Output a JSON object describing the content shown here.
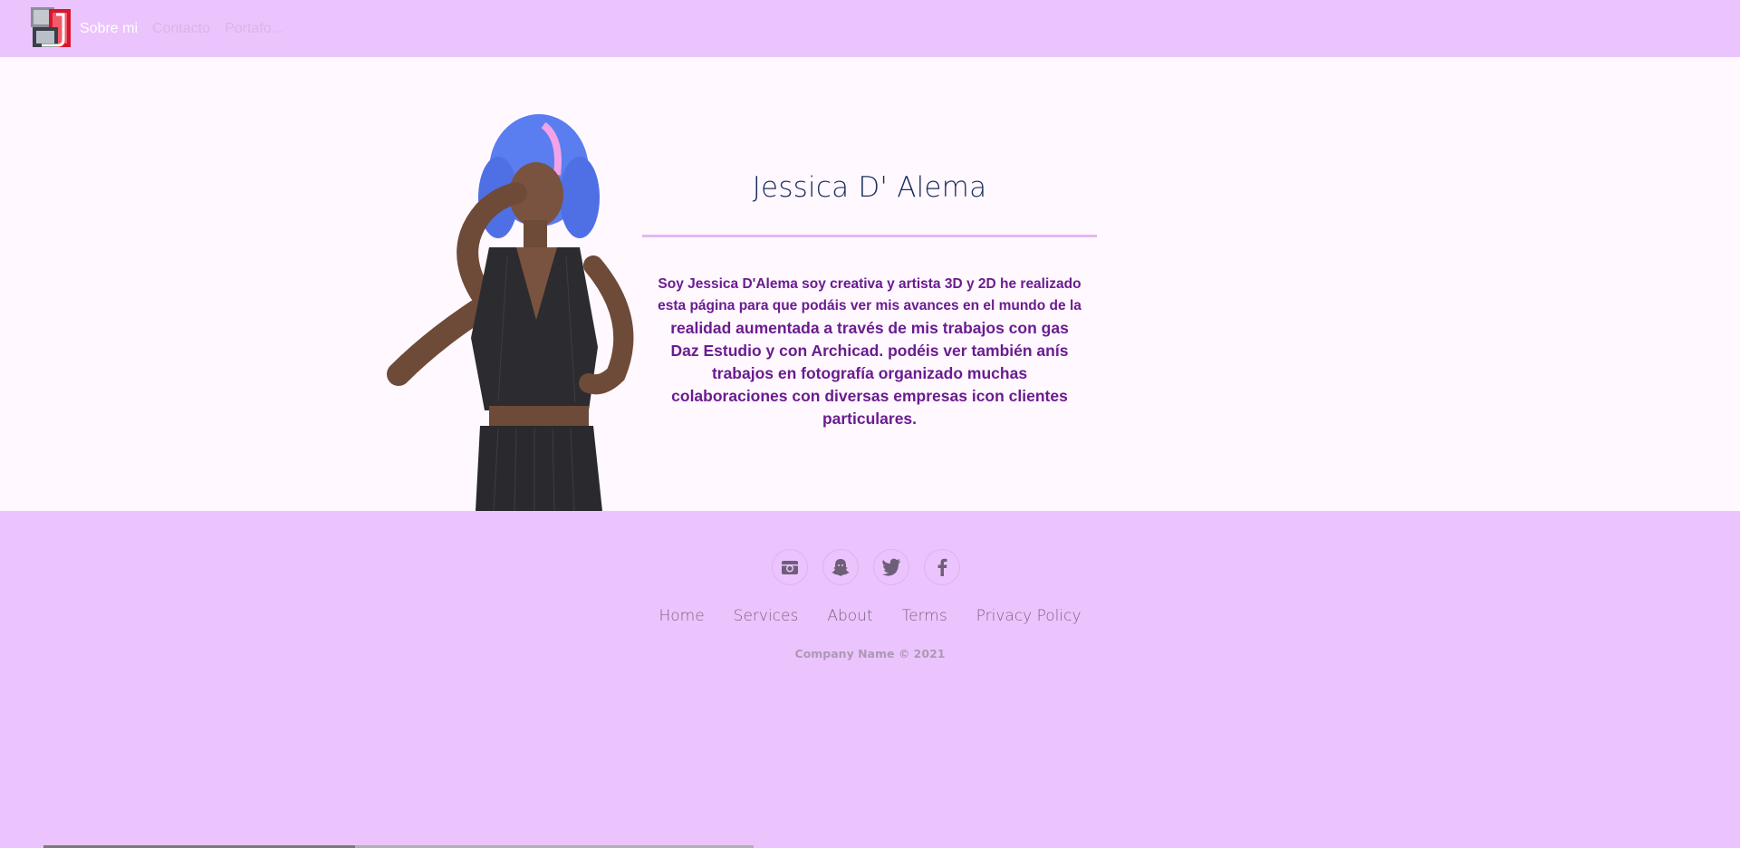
{
  "nav": {
    "logo_icon": "jd-monogram-logo",
    "links": [
      {
        "label": "Sobre mi",
        "state": "active"
      },
      {
        "label": "Contacto",
        "state": "inactive"
      },
      {
        "label": "Portafo...",
        "state": "inactive"
      }
    ]
  },
  "hero": {
    "name": "Jessica D' Alema",
    "bio_lines_small": [
      "Soy Jessica D'Alema soy creativa y  artista 3D y 2D he realizado",
      "esta página para que podáis ver mis avances en el mundo de la"
    ],
    "bio_lines_large": [
      "realidad aumentada a través de mis trabajos con gas",
      "Daz Estudio y con Archicad. podéis ver también anís",
      "trabajos en fotografía organizado muchas",
      "colaboraciones con diversas empresas icon clientes",
      "particulares."
    ]
  },
  "footer": {
    "social": [
      {
        "icon": "instagram-icon"
      },
      {
        "icon": "snapchat-icon"
      },
      {
        "icon": "twitter-icon"
      },
      {
        "icon": "facebook-icon"
      }
    ],
    "links": [
      "Home",
      "Services",
      "About",
      "Terms",
      "Privacy Policy"
    ],
    "copyright": "Company Name © 2021"
  },
  "colors": {
    "nav_bg": "#ebc4fd",
    "main_bg": "#fff8ff",
    "heading": "#1b2e5c",
    "bio_text": "#6a1c8f",
    "footer_link": "#7a6582"
  }
}
